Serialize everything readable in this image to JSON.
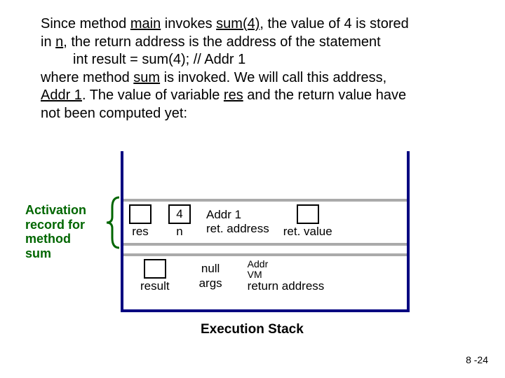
{
  "prose": {
    "l1a": "Since method ",
    "l1b": "main",
    "l1c": " invokes ",
    "l1d": "sum(4)",
    "l1e": ", the value of 4 is stored",
    "l2a": "in ",
    "l2b": "n",
    "l2c": ", the return address is the address of the statement",
    "code": "int result = sum(4); // Addr 1",
    "l4a": "where method ",
    "l4b": "sum",
    "l4c": " is invoked. We will call this address,",
    "l5a": "Addr 1",
    "l5b": ". The value of variable ",
    "l5c": "res",
    "l5d": " and the return value have",
    "l6": "not been computed yet:"
  },
  "ar_label": {
    "l1": "Activation",
    "l2": "record for",
    "l3": "method",
    "l4": "sum"
  },
  "sum_row": {
    "res_label": "res",
    "n_value": "4",
    "n_label": "n",
    "addr_top": "Addr 1",
    "addr_label": "ret. address",
    "retval_label": "ret. value"
  },
  "main_row": {
    "result_label": "result",
    "args_value": "null",
    "args_label": "args",
    "ra_top1": "Addr",
    "ra_top2": "VM",
    "ra_label": "return address"
  },
  "caption": "Execution Stack",
  "pagenum": "8 -24"
}
